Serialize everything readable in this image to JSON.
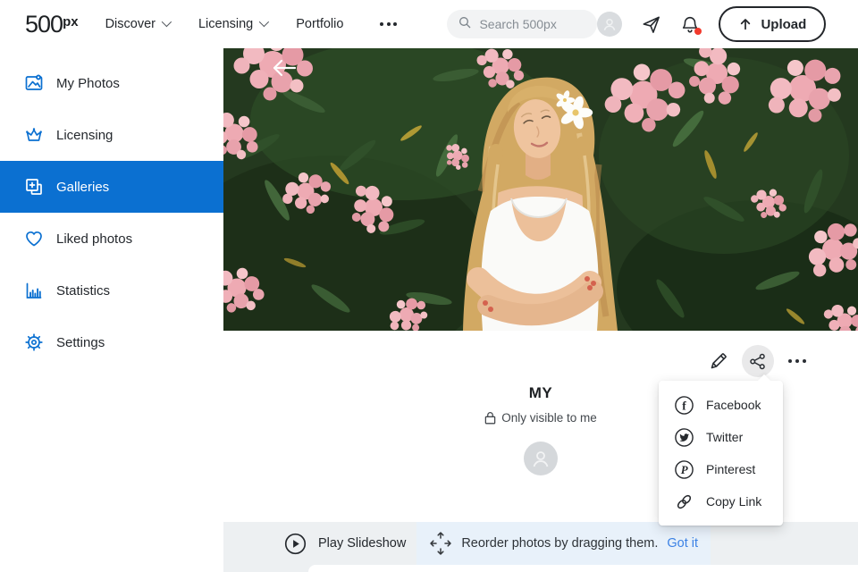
{
  "nav": {
    "logo_base": "500",
    "logo_sup": "px",
    "items": [
      {
        "label": "Discover"
      },
      {
        "label": "Licensing"
      },
      {
        "label": "Portfolio"
      }
    ],
    "search_placeholder": "Search 500px",
    "upload_label": "Upload"
  },
  "sidebar": {
    "items": [
      {
        "label": "My Photos"
      },
      {
        "label": "Licensing"
      },
      {
        "label": "Galleries"
      },
      {
        "label": "Liked photos"
      },
      {
        "label": "Statistics"
      },
      {
        "label": "Settings"
      }
    ],
    "selected_index": 2
  },
  "gallery": {
    "title": "MY",
    "visibility": "Only visible to me"
  },
  "share_menu": {
    "items": [
      {
        "label": "Facebook",
        "glyph": "f"
      },
      {
        "label": "Twitter",
        "glyph": ""
      },
      {
        "label": "Pinterest",
        "glyph": "P"
      },
      {
        "label": "Copy Link",
        "glyph": ""
      }
    ]
  },
  "toolbar": {
    "play_label": "Play Slideshow",
    "reorder_text": "Reorder photos by dragging them.",
    "got_it_label": "Got it"
  },
  "colors": {
    "accent_blue": "#0b70d1",
    "link_blue": "#3c82e5",
    "notification_red": "#f2392c"
  }
}
